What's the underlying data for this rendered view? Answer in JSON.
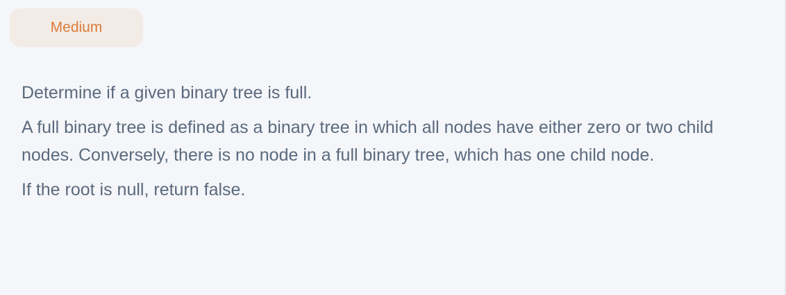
{
  "difficulty": {
    "label": "Medium",
    "text_color": "#db7b39",
    "bg_color": "#f3ece6"
  },
  "description": {
    "paragraphs": [
      "Determine if a given binary tree is full.",
      "A full binary tree is defined as a binary tree in which all nodes have either zero or two child nodes. Conversely, there is no node in a full binary tree, which has one child node.",
      "If the root is null, return false."
    ]
  },
  "colors": {
    "background": "#f5f6fa",
    "text": "#5a6a7d"
  }
}
